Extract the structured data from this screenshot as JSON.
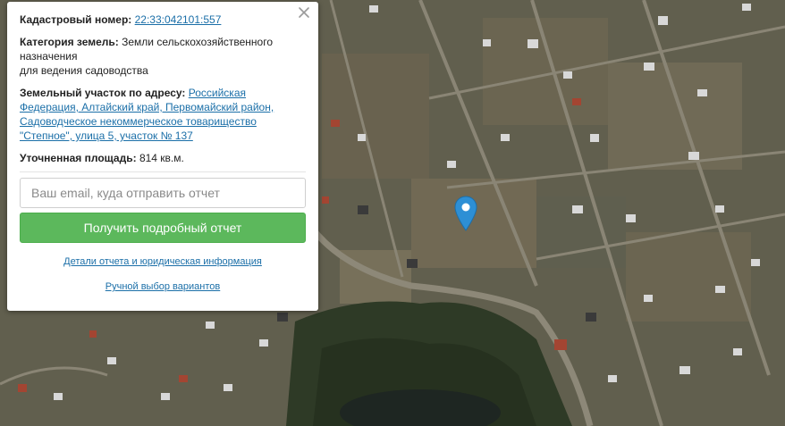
{
  "card": {
    "cadastral_label": "Кадастровый номер:",
    "cadastral_value": "22:33:042101:557",
    "category_label": "Категория земель:",
    "category_value_line1": "Земли сельскохозяйственного назначения",
    "category_value_line2": "для ведения садоводства",
    "address_label": "Земельный участок по адресу:",
    "address_value": "Российская Федерация, Алтайский край, Первомайский район, Садоводческое некоммерческое товарищество \"Степное\", улица 5, участок № 137",
    "area_label": "Уточненная площадь:",
    "area_value": "814 кв.м.",
    "email_placeholder": "Ваш email, куда отправить отчет",
    "submit_label": "Получить подробный отчет",
    "details_link": "Детали отчета и юридическая информация",
    "manual_link": "Ручной выбор вариантов"
  },
  "icons": {
    "close": "close-icon",
    "pin": "map-pin-icon"
  },
  "colors": {
    "accent_green": "#5cb85c",
    "link_blue": "#1b6fa8",
    "pin_blue": "#2d8fd5"
  }
}
